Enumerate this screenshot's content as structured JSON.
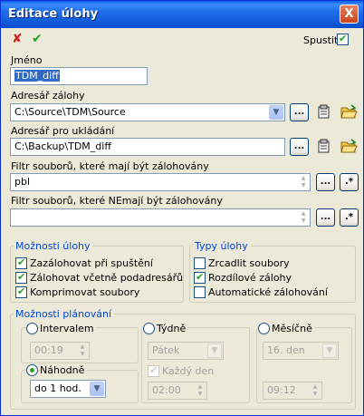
{
  "window": {
    "title": "Editace úlohy",
    "close_glyph": "X"
  },
  "toolbar": {
    "cancel_glyph": "✘",
    "ok_glyph": "✔",
    "spustit_label": "Spustit",
    "spustit_checked": true
  },
  "jmeno": {
    "label": "Jméno",
    "value": "TDM_diff"
  },
  "adresar_zalohy": {
    "label": "Adresář zálohy",
    "value": "C:\\Source\\TDM\\Source"
  },
  "adresar_ukladani": {
    "label": "Adresář pro ukládání",
    "value": "C:\\Backup\\TDM_diff"
  },
  "filtr_zalohovany": {
    "label": "Filtr souborů, které mají být zálohovány",
    "value": "pbl"
  },
  "filtr_nezalohovany": {
    "label": "Filtr souborů, které NEmají být zálohovány",
    "value": ""
  },
  "buttons": {
    "browse_label": "...",
    "wildcard_label": ".*"
  },
  "moznosti_ulohy": {
    "title": "Možnosti úlohy",
    "items": [
      {
        "label": "Zazálohovat při spuštění",
        "checked": true
      },
      {
        "label": "Zálohovat včetně podadresářů",
        "checked": true
      },
      {
        "label": "Komprimovat soubory",
        "checked": true
      }
    ]
  },
  "typy_ulohy": {
    "title": "Typy úlohy",
    "items": [
      {
        "label": "Zrcadlit soubory",
        "checked": false
      },
      {
        "label": "Rozdílové zálohy",
        "checked": true
      },
      {
        "label": "Automatické zálohování",
        "checked": false
      }
    ]
  },
  "moznosti_planovani": {
    "title": "Možnosti plánování",
    "intervalem": {
      "label": "Intervalem",
      "selected": false,
      "value": "00:19"
    },
    "nahodne": {
      "label": "Náhodně",
      "selected": true,
      "value": "do 1 hod."
    },
    "tydne": {
      "label": "Týdně",
      "selected": false,
      "day_value": "Pátek",
      "kazdy_den_label": "Každý den",
      "kazdy_den_checked": true,
      "time_value": "02:00"
    },
    "mesicne": {
      "label": "Měsíčně",
      "selected": false,
      "day_value": "16. den",
      "time_value": "09:12"
    }
  },
  "colors": {
    "titlebar": "#0a5ce8",
    "group_title": "#0046d5",
    "window_bg": "#ece9d8",
    "checkmark": "#21a121"
  }
}
